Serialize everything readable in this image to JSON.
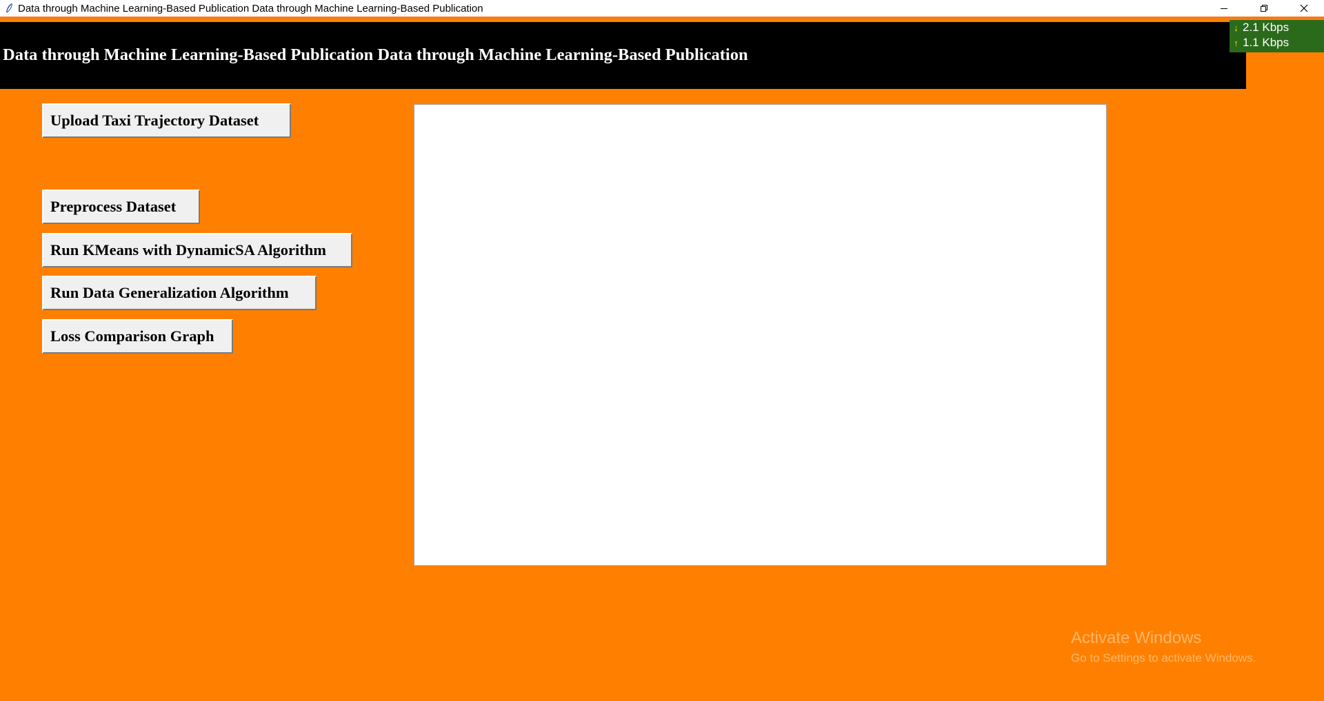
{
  "window": {
    "title": "Data through Machine Learning-Based Publication Data through Machine Learning-Based Publication",
    "icon": "feather-icon",
    "controls": [
      "minimize-icon",
      "restore-icon",
      "close-icon"
    ]
  },
  "network_monitor": {
    "download": "2.1 Kbps",
    "upload": "1.1 Kbps",
    "colors": {
      "background": "#2b6a1b",
      "arrow": "#f3e600"
    }
  },
  "header": {
    "title": "Data through Machine Learning-Based Publication Data through Machine Learning-Based Publication"
  },
  "buttons": {
    "upload": "Upload Taxi Trajectory Dataset",
    "preprocess": "Preprocess Dataset",
    "kmeans": "Run KMeans with DynamicSA Algorithm",
    "generalization": "Run Data Generalization Algorithm",
    "loss_graph": "Loss Comparison Graph"
  },
  "output": {
    "text": ""
  },
  "watermark": {
    "title": "Activate Windows",
    "subtitle": "Go to Settings to activate Windows."
  },
  "colors": {
    "background": "#ff8000",
    "header_background": "#000000",
    "header_text": "#ffffff",
    "button_face": "#f0f0f0"
  }
}
